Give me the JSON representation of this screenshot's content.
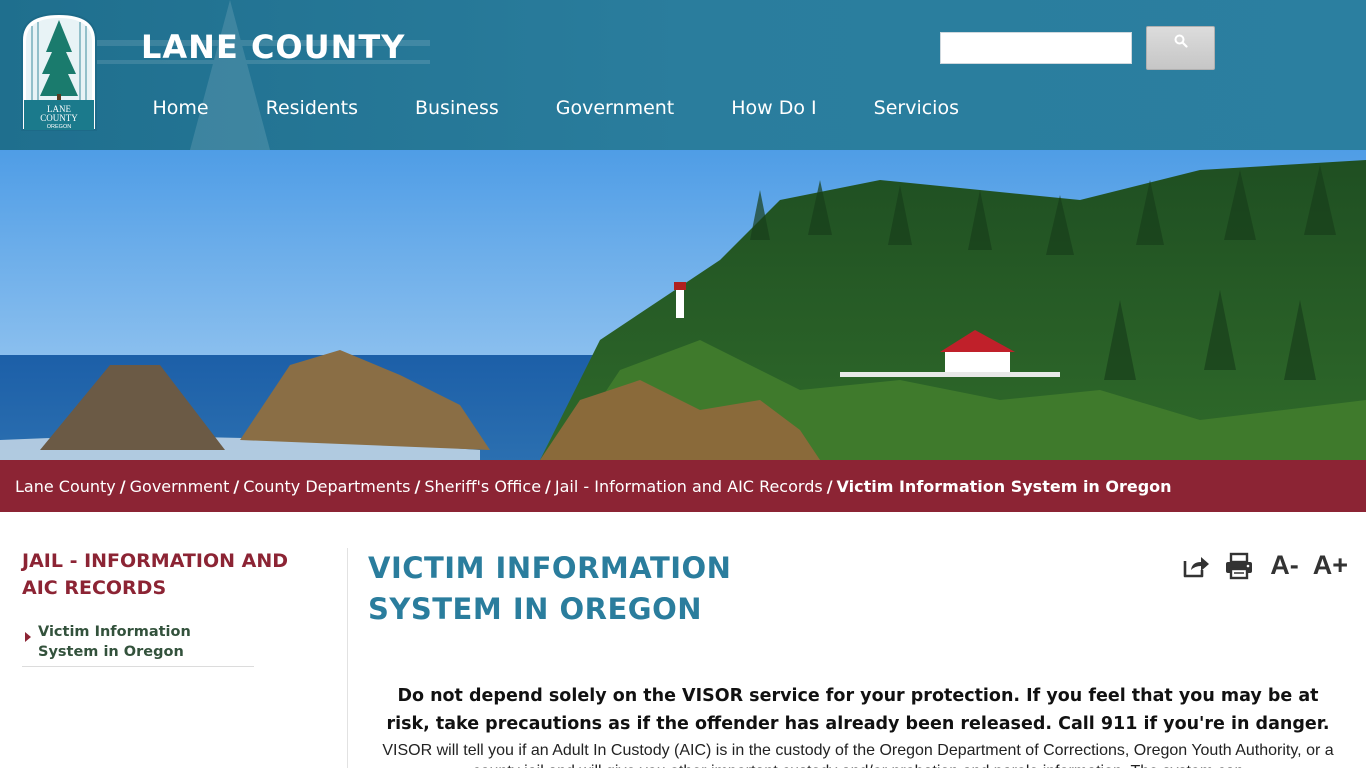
{
  "site": {
    "title": "LANE COUNTY",
    "logo_text": [
      "LANE",
      "COUNTY",
      "OREGON"
    ]
  },
  "search": {
    "placeholder": "",
    "value": "",
    "button_icon": "search-icon"
  },
  "nav": {
    "items": [
      "Home",
      "Residents",
      "Business",
      "Government",
      "How Do I",
      "Servicios"
    ]
  },
  "breadcrumb": {
    "items": [
      "Lane County",
      "Government",
      "County Departments",
      "Sheriff's Office",
      "Jail - Information and AIC Records"
    ],
    "current": "Victim Information System in Oregon",
    "separator": "/"
  },
  "sidebar": {
    "heading": "JAIL - INFORMATION AND AIC RECORDS",
    "items": [
      {
        "label": "Victim Information System in Oregon"
      }
    ]
  },
  "main": {
    "title": "VICTIM INFORMATION SYSTEM IN OREGON",
    "tools": {
      "share_icon": "share-icon",
      "print_icon": "print-icon",
      "font_decrease": "A-",
      "font_increase": "A+"
    },
    "warning": "Do not depend solely on the VISOR service for your protection. If you feel that you may be at risk, take precautions as if the offender has already been released.  Call 911 if you're in danger.",
    "body": "VISOR will tell you if an Adult In Custody (AIC) is in the custody of the Oregon Department of Corrections, Oregon Youth Authority, or a county jail and will give you other important custody and/or probation and parole information.  The system can"
  },
  "colors": {
    "header_blue": "#2a7d9d",
    "breadcrumb_bg": "#8c2434",
    "sidebar_heading": "#8c2434",
    "title_blue": "#2a7d9d",
    "sidebar_link": "#33523c"
  }
}
